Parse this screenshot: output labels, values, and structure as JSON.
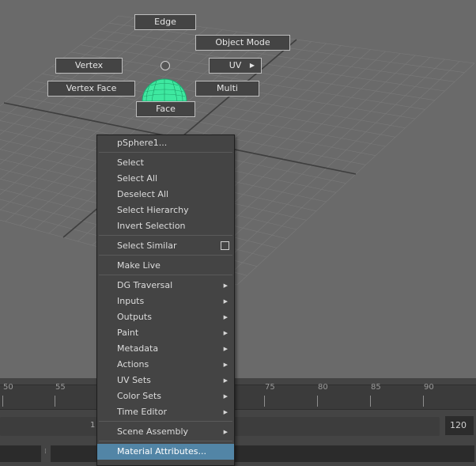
{
  "marking_menu": {
    "edge": "Edge",
    "object_mode": "Object Mode",
    "vertex": "Vertex",
    "uv": "UV",
    "vertex_face": "Vertex Face",
    "multi": "Multi",
    "face": "Face",
    "submenu_arrow": "▶"
  },
  "context_menu": {
    "items": [
      {
        "label": "pSphere1..."
      },
      {
        "label": "Select"
      },
      {
        "label": "Select All"
      },
      {
        "label": "Deselect All"
      },
      {
        "label": "Select Hierarchy"
      },
      {
        "label": "Invert Selection"
      },
      {
        "label": "Select Similar"
      },
      {
        "label": "Make Live"
      },
      {
        "label": "DG Traversal"
      },
      {
        "label": "Inputs"
      },
      {
        "label": "Outputs"
      },
      {
        "label": "Paint"
      },
      {
        "label": "Metadata"
      },
      {
        "label": "Actions"
      },
      {
        "label": "UV Sets"
      },
      {
        "label": "Color Sets"
      },
      {
        "label": "Time Editor"
      },
      {
        "label": "Scene Assembly"
      },
      {
        "label": "Material Attributes..."
      }
    ],
    "submenu_arrow": "▶",
    "highlight_color": "#5285a6"
  },
  "timeline": {
    "ticks": [
      "50",
      "55",
      "75",
      "80",
      "85",
      "90"
    ],
    "range_start": "1",
    "range_end": "120"
  },
  "colors": {
    "viewport": "#6a6a6a",
    "sphere": "#3ee8a0"
  }
}
